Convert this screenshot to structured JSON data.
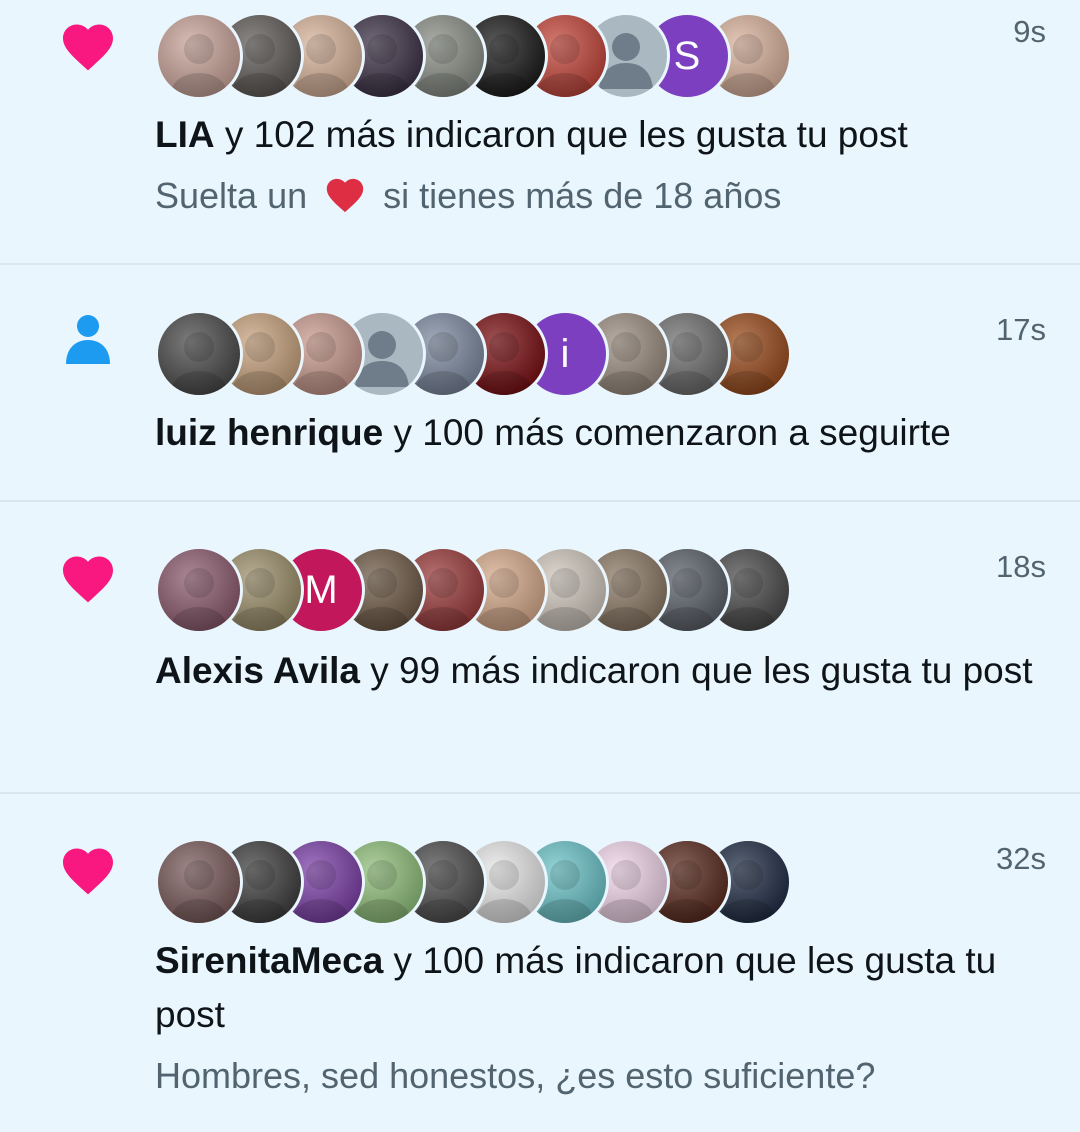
{
  "colors": {
    "background": "#e9f6fd",
    "like_icon": "#f91880",
    "follow_icon": "#1d9bf0",
    "meta_text": "#536471"
  },
  "notifications": [
    {
      "type": "like",
      "icon": "heart-icon",
      "time": "9s",
      "actor": "LIA",
      "action": " y 102 más indicaron que les gusta tu post",
      "preview_before": "Suelta un ",
      "preview_after": " si tienes más de 18 años",
      "avatars": [
        {
          "kind": "photo",
          "color": "#c9a49a"
        },
        {
          "kind": "photo",
          "color": "#5f5b57"
        },
        {
          "kind": "photo",
          "color": "#d8b39a"
        },
        {
          "kind": "photo",
          "color": "#3c3146"
        },
        {
          "kind": "photo",
          "color": "#8a8f86"
        },
        {
          "kind": "photo",
          "color": "#1a1a1a"
        },
        {
          "kind": "photo",
          "color": "#c4463a"
        },
        {
          "kind": "default",
          "color": "#aab8c2"
        },
        {
          "kind": "letter",
          "color": "#7b3fbf",
          "letter": "S"
        },
        {
          "kind": "photo",
          "color": "#d9b29c"
        }
      ]
    },
    {
      "type": "follow",
      "icon": "person-icon",
      "time": "17s",
      "actor": "luiz henrique",
      "action": " y 100 más comenzaron a seguirte",
      "avatars": [
        {
          "kind": "photo",
          "color": "#4a4a4a"
        },
        {
          "kind": "photo",
          "color": "#c7a27d"
        },
        {
          "kind": "photo",
          "color": "#c99a8e"
        },
        {
          "kind": "default",
          "color": "#aab8c2"
        },
        {
          "kind": "photo",
          "color": "#7d8aa0"
        },
        {
          "kind": "photo",
          "color": "#7a0e12"
        },
        {
          "kind": "letter",
          "color": "#7b3fbf",
          "letter": "i"
        },
        {
          "kind": "photo",
          "color": "#9c8d80"
        },
        {
          "kind": "photo",
          "color": "#6f6f6f"
        },
        {
          "kind": "photo",
          "color": "#9a4b1c"
        }
      ]
    },
    {
      "type": "like",
      "icon": "heart-icon",
      "time": "18s",
      "actor": "Alexis Avila",
      "action": " y 99 más indicaron que les gusta tu post",
      "avatars": [
        {
          "kind": "photo",
          "color": "#8c5a6e"
        },
        {
          "kind": "photo",
          "color": "#9c8f6a"
        },
        {
          "kind": "letter",
          "color": "#c2185b",
          "letter": "M"
        },
        {
          "kind": "photo",
          "color": "#6e5a46"
        },
        {
          "kind": "photo",
          "color": "#9b3a3a"
        },
        {
          "kind": "photo",
          "color": "#d6a98a"
        },
        {
          "kind": "photo",
          "color": "#cfc7bd"
        },
        {
          "kind": "photo",
          "color": "#8a7864"
        },
        {
          "kind": "photo",
          "color": "#5a6068"
        },
        {
          "kind": "photo",
          "color": "#4a4a4a"
        }
      ]
    },
    {
      "type": "like",
      "icon": "heart-icon",
      "time": "32s",
      "actor": "SirenitaMeca",
      "action": " y 100 más indicaron que les gusta tu post",
      "preview_before": "Hombres, sed honestos, ¿es esto suficiente?",
      "preview_after": "",
      "avatars": [
        {
          "kind": "photo",
          "color": "#7a5a5a"
        },
        {
          "kind": "photo",
          "color": "#3e3e3e"
        },
        {
          "kind": "photo",
          "color": "#7c3fa8"
        },
        {
          "kind": "photo",
          "color": "#8fbf7a"
        },
        {
          "kind": "photo",
          "color": "#4d4d4d"
        },
        {
          "kind": "photo",
          "color": "#e8e8e8"
        },
        {
          "kind": "photo",
          "color": "#6bc4c9"
        },
        {
          "kind": "photo",
          "color": "#f2d6ea"
        },
        {
          "kind": "photo",
          "color": "#5a2a1e"
        },
        {
          "kind": "photo",
          "color": "#1f2c44"
        }
      ]
    }
  ]
}
